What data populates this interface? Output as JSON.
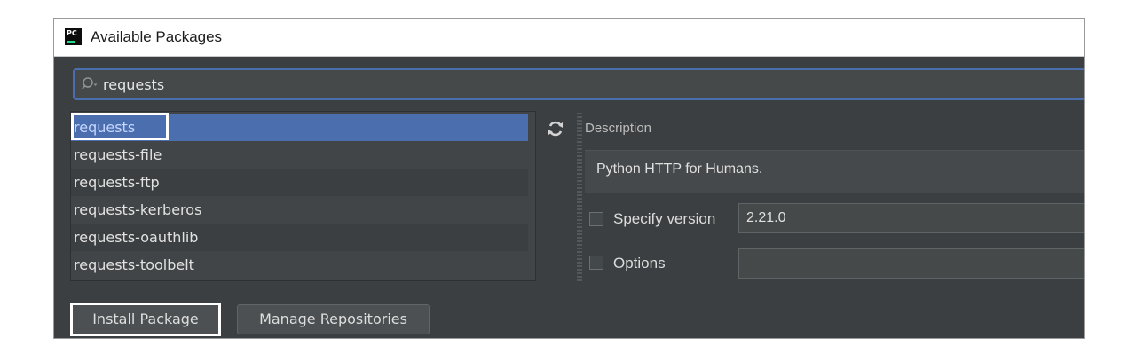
{
  "window": {
    "title": "Available Packages",
    "logo_text": "PC",
    "logo_icon": "pycharm-logo-icon"
  },
  "search": {
    "value": "requests",
    "icon": "search-icon"
  },
  "packages": {
    "items": [
      {
        "label": "requests",
        "selected": true
      },
      {
        "label": "requests-file"
      },
      {
        "label": "requests-ftp"
      },
      {
        "label": "requests-kerberos"
      },
      {
        "label": "requests-oauthlib"
      },
      {
        "label": "requests-toolbelt"
      }
    ],
    "refresh_icon": "refresh-icon"
  },
  "details": {
    "description_label": "Description",
    "description_text": "Python HTTP for Humans.",
    "specify_version_label": "Specify version",
    "version_value": "2.21.0",
    "specify_version_checked": false,
    "options_label": "Options",
    "options_value": "",
    "options_checked": false
  },
  "buttons": {
    "install_label": "Install Package",
    "manage_label": "Manage Repositories"
  },
  "colors": {
    "background": "#3c3f41",
    "selection": "#4b6eaf",
    "annotation_outline": "#ffffff"
  }
}
